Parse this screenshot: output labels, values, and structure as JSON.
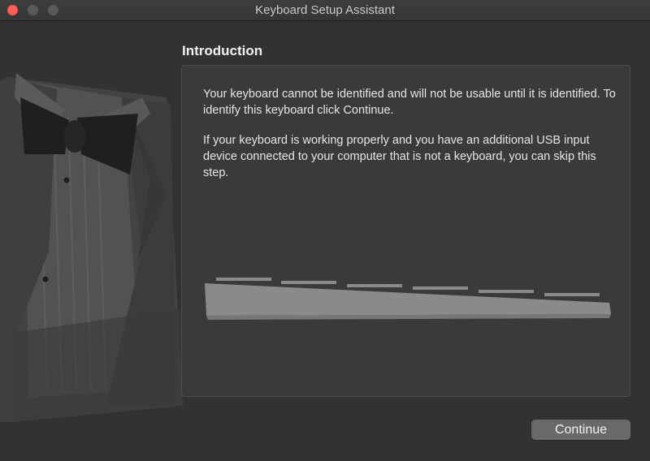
{
  "window": {
    "title": "Keyboard Setup Assistant"
  },
  "content": {
    "heading": "Introduction",
    "paragraph1": "Your keyboard cannot be identified and will not be usable until it is identified. To identify this keyboard click Continue.",
    "paragraph2": "If your keyboard is working properly and you have an additional USB input device connected to your computer that is not a keyboard, you can skip this step."
  },
  "buttons": {
    "continue_label": "Continue"
  },
  "icons": {
    "window_close": "close-icon",
    "window_minimize": "minimize-icon",
    "window_zoom": "zoom-icon",
    "illustration": "tuxedo-illustration",
    "keyboard": "keyboard-illustration"
  },
  "colors": {
    "close": "#fe5f57",
    "window_bg": "#323232",
    "button": "#696969"
  }
}
